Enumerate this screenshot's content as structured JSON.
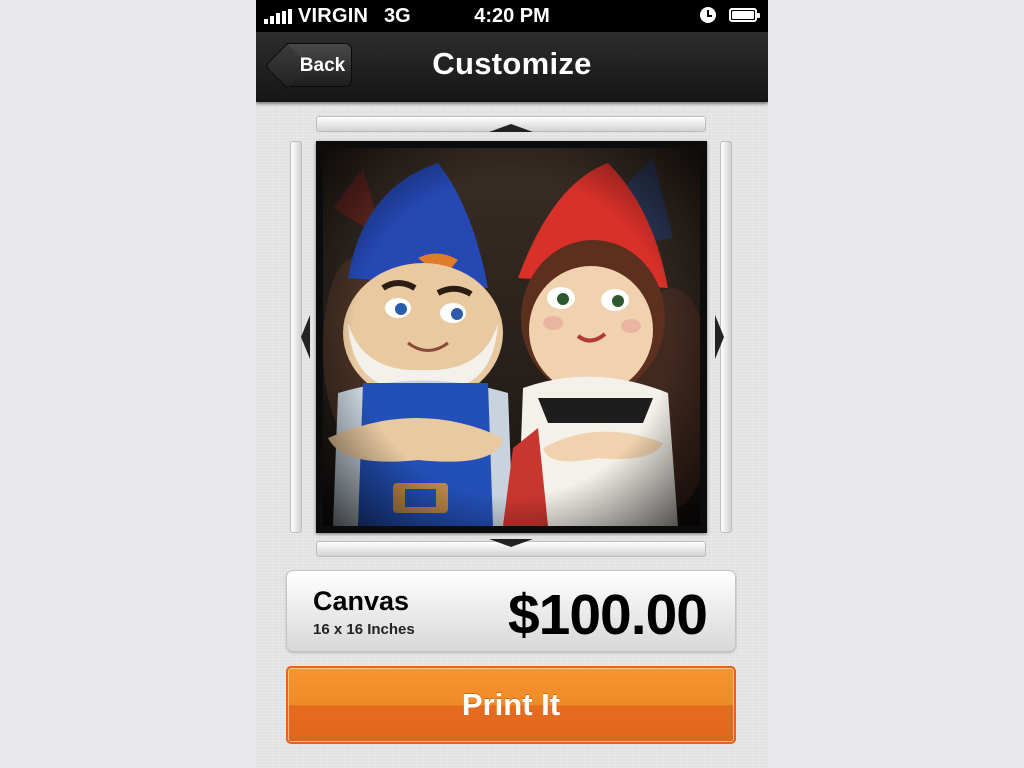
{
  "status_bar": {
    "carrier": "VIRGIN",
    "network": "3G",
    "time": "4:20 PM",
    "icons": [
      "signal-icon",
      "alarm-icon",
      "battery-icon"
    ]
  },
  "nav": {
    "back_label": "Back",
    "title": "Customize"
  },
  "crop_controls": {
    "icons": [
      "arrow-up-icon",
      "arrow-down-icon",
      "arrow-left-icon",
      "arrow-right-icon"
    ]
  },
  "product": {
    "name": "Canvas",
    "size": "16 x 16 Inches",
    "price": "$100.00"
  },
  "actions": {
    "print_label": "Print It"
  },
  "colors": {
    "accent": "#f08a27",
    "nav_background": "#1e1e1e",
    "page_background": "#e4e4e4"
  }
}
